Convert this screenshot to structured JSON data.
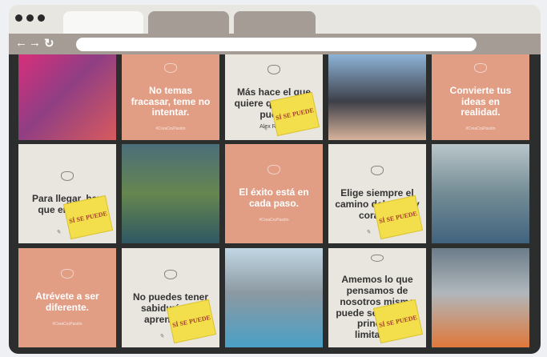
{
  "browser": {
    "tabs": [
      "",
      "",
      ""
    ],
    "address": "",
    "nav": {
      "back": "←",
      "forward": "→",
      "reload": "↻"
    }
  },
  "gallery": {
    "tiles": [
      {
        "kind": "photo",
        "alt": "Woman at floral arch"
      },
      {
        "kind": "quote",
        "lines": [
          "No temas",
          "fracasar, teme no",
          "intentar."
        ],
        "hash": "#CreaCruPasión"
      },
      {
        "kind": "quote-book",
        "text": "Más hace el que quiere que el que puede",
        "author": "Alex Rovira",
        "book": "SÍ SE PUEDE"
      },
      {
        "kind": "photo",
        "alt": "Group of women smiling"
      },
      {
        "kind": "quote",
        "lines": [
          "Convierte tus",
          "ideas en",
          "realidad."
        ],
        "hash": "#CreaCruPasión"
      },
      {
        "kind": "quote-book",
        "text": "Para llegar, hay que empezar",
        "book": "SÍ SE PUEDE"
      },
      {
        "kind": "photo",
        "alt": "Woman at riverside"
      },
      {
        "kind": "quote",
        "lines": [
          "El éxito está en",
          "cada paso."
        ],
        "hash": "#CreaCruPasión"
      },
      {
        "kind": "quote-book",
        "text": "Elige siempre el camino del amor y corazón",
        "book": "SÍ SE PUEDE"
      },
      {
        "kind": "photo",
        "alt": "Woman jumping by mountains"
      },
      {
        "kind": "quote",
        "lines": [
          "Atrévete a ser",
          "diferente."
        ],
        "hash": "#CreaCruPasión"
      },
      {
        "kind": "quote-book",
        "text": "No puedes tener sabiduría sin aprendizaje",
        "book": "SÍ SE PUEDE"
      },
      {
        "kind": "photo",
        "alt": "Woman in white dress"
      },
      {
        "kind": "quote-book",
        "text": "Amemos lo que pensamos de nosotros mismo puede ser nuestra principal limitación",
        "book": "SÍ SE PUEDE"
      },
      {
        "kind": "photo",
        "alt": "Woman smiling in orange blouse"
      }
    ]
  }
}
